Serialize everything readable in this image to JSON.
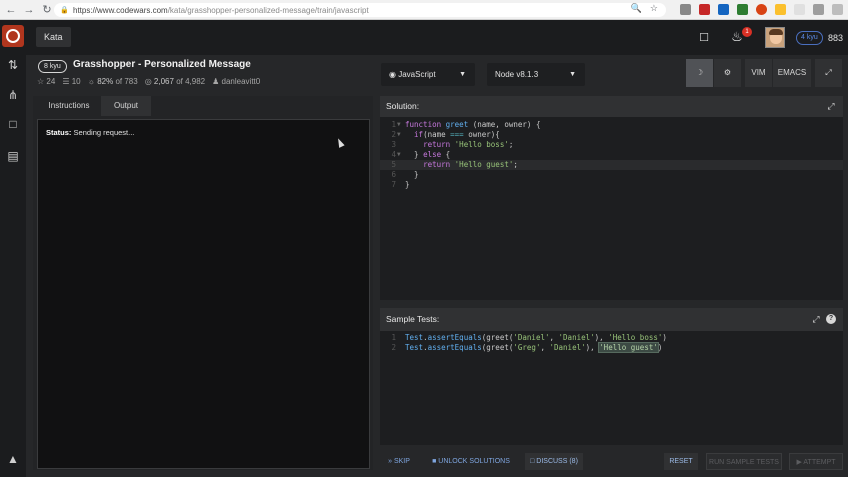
{
  "browser": {
    "url_host": "https://www.codewars.com",
    "url_path": "/kata/grasshopper-personalized-message/train/javascript"
  },
  "topbar": {
    "kata_tab": "Kata",
    "notification_count": "1",
    "rank": "4 kyu",
    "honor": "883"
  },
  "kata": {
    "kyu": "8 kyu",
    "title": "Grasshopper - Personalized Message",
    "stars": "24",
    "collections": "10",
    "satisfaction": "82%",
    "satisfaction_of": "of 783",
    "completed": "2,067",
    "completed_of": "of 4,982",
    "author": "danleavitt0"
  },
  "controls": {
    "language": "JavaScript",
    "runtime": "Node v8.1.3",
    "vim": "VIM",
    "emacs": "EMACS"
  },
  "left_panel": {
    "tabs": [
      "Instructions",
      "Output"
    ],
    "status_label": "Status:",
    "status_text": "Sending request..."
  },
  "solution": {
    "title": "Solution:",
    "lines": [
      "function greet (name, owner) {",
      "  if(name === owner){",
      "    return 'Hello boss';",
      "  } else {",
      "    return 'Hello guest';",
      "  }",
      "}"
    ]
  },
  "sample_tests": {
    "title": "Sample Tests:",
    "lines": [
      "Test.assertEquals(greet('Daniel', 'Daniel'), 'Hello boss')",
      "Test.assertEquals(greet('Greg', 'Daniel'), 'Hello guest')"
    ]
  },
  "actions": {
    "skip": "SKIP",
    "unlock": "UNLOCK SOLUTIONS",
    "discuss": "DISCUSS (8)",
    "reset": "RESET",
    "run_tests": "RUN SAMPLE TESTS",
    "attempt": "ATTEMPT"
  },
  "colors": {
    "brand_red": "#b1361e",
    "link_blue": "#7fa6e0",
    "background": "#262729"
  }
}
